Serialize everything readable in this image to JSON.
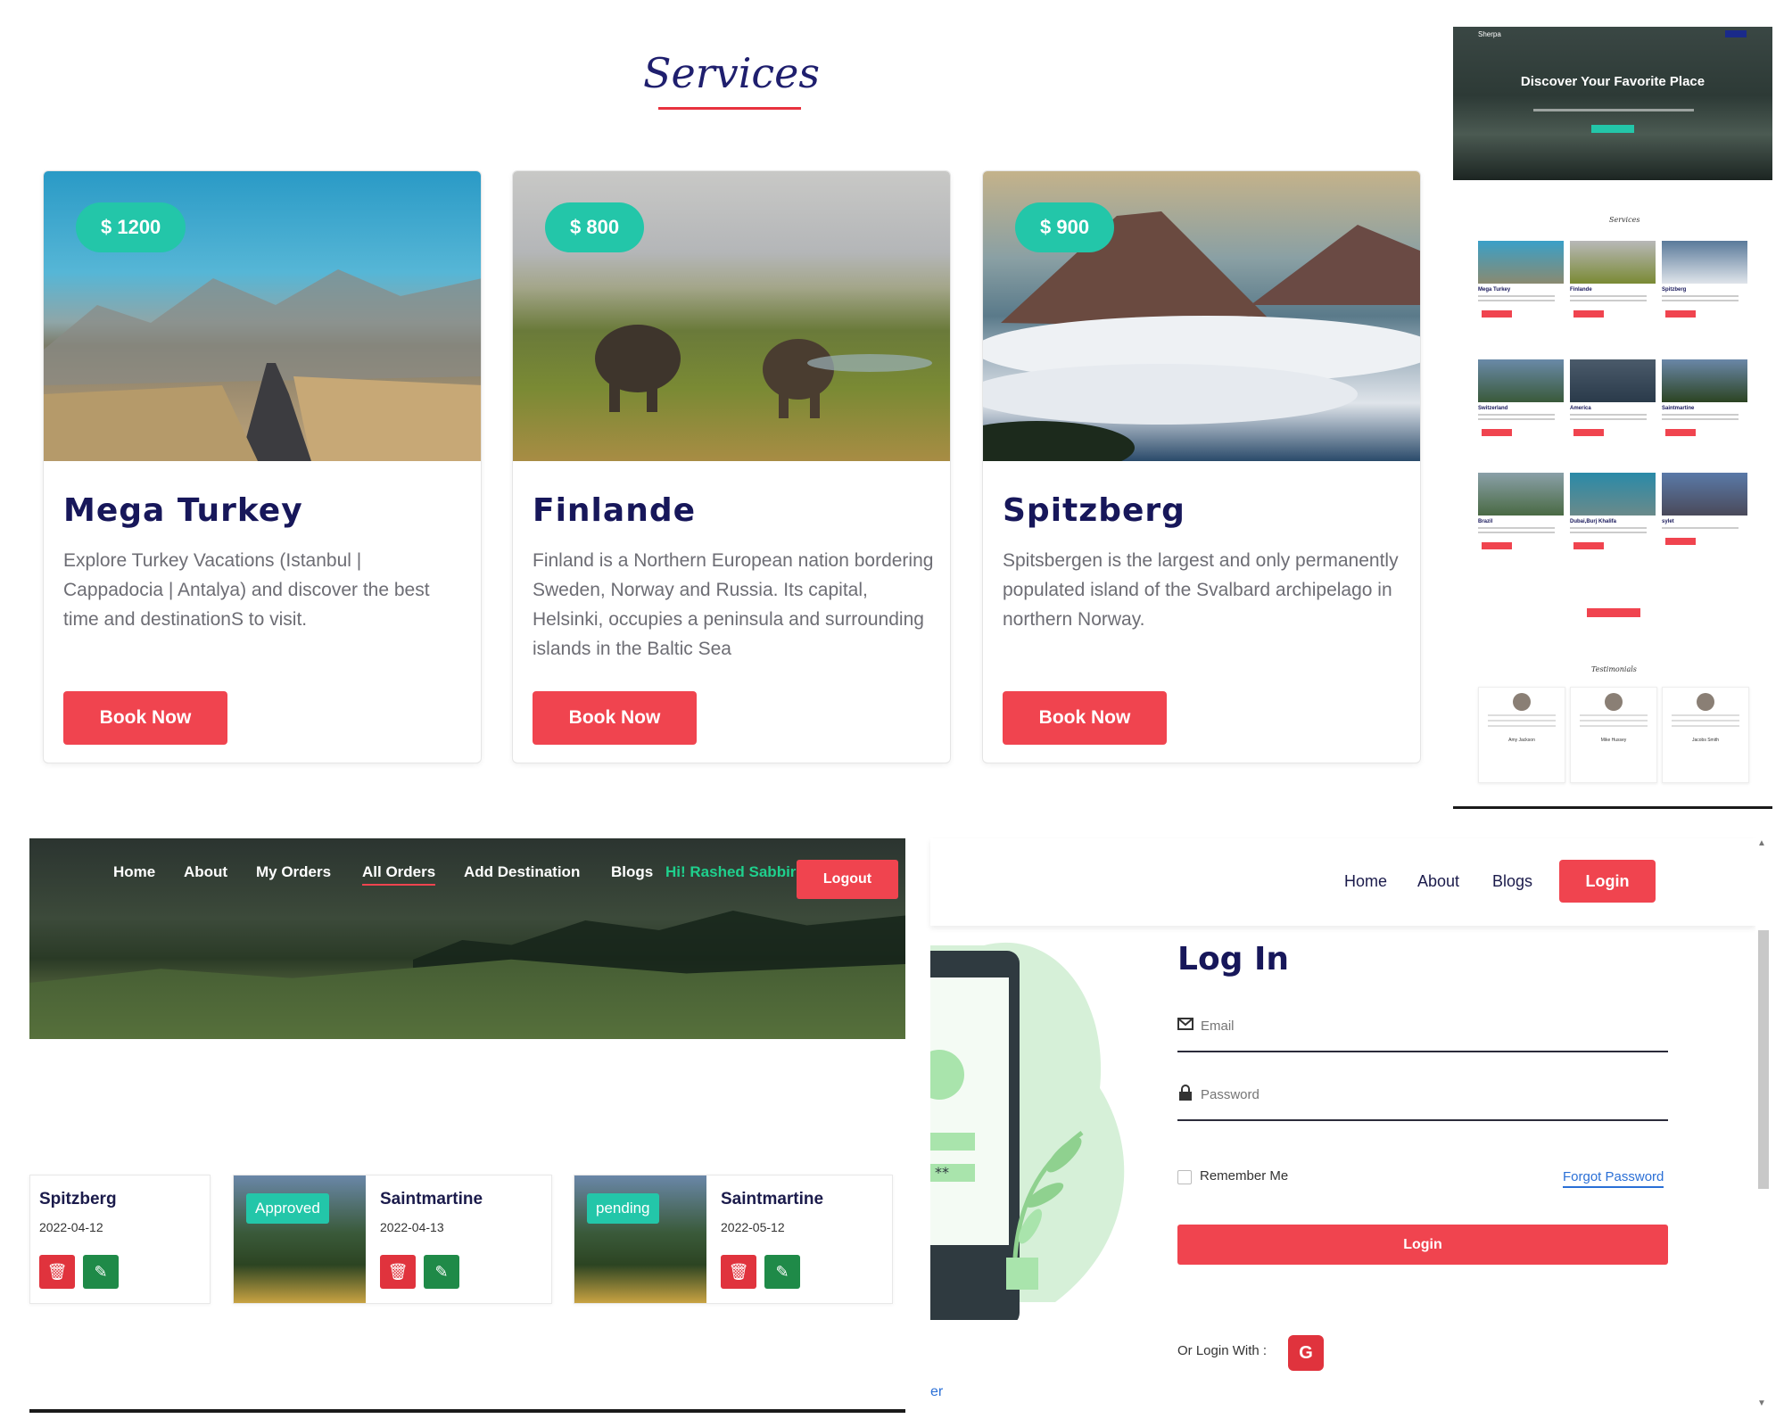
{
  "services": {
    "title": "Services",
    "cards": [
      {
        "price": "$ 1200",
        "title": "Mega Turkey",
        "desc": "Explore Turkey Vacations (Istanbul | Cappadocia | Antalya) and discover the best time and destinationS to visit.",
        "button": "Book Now"
      },
      {
        "price": "$ 800",
        "title": "Finlande",
        "desc": "Finland is a Northern European nation bordering Sweden, Norway and Russia. Its capital, Helsinki, occupies a peninsula and surrounding islands in the Baltic Sea",
        "button": "Book Now"
      },
      {
        "price": "$ 900",
        "title": "Spitzberg",
        "desc": "Spitsbergen is the largest and only permanently populated island of the Svalbard archipelago in northern Norway.",
        "button": "Book Now"
      }
    ]
  },
  "preview": {
    "logo": "Sherpa",
    "hero_title": "Discover Your Favorite Place",
    "services_label": "Services",
    "testimonials_label": "Testimonials",
    "cards": [
      "Mega Turkey",
      "Finlande",
      "Spitzberg",
      "Switzerland",
      "America",
      "Saintmartine",
      "Brazil",
      "Dubai,Burj Khalifa",
      "sylet"
    ],
    "testimonials": [
      "Amy Jackson",
      "Mike Hussey",
      "Jacobs Smith"
    ]
  },
  "orders": {
    "nav": {
      "home": "Home",
      "about": "About",
      "my_orders": "My Orders",
      "all_orders": "All Orders",
      "add_destination": "Add Destination",
      "blogs": "Blogs",
      "user": "Hi! Rashed Sabbir",
      "logout": "Logout"
    },
    "items": [
      {
        "title": "Spitzberg",
        "date": "2022-04-12",
        "status": ""
      },
      {
        "title": "Saintmartine",
        "date": "2022-04-13",
        "status": "Approved"
      },
      {
        "title": "Saintmartine",
        "date": "2022-05-12",
        "status": "pending"
      }
    ]
  },
  "login": {
    "nav": {
      "home": "Home",
      "about": "About",
      "blogs": "Blogs",
      "login": "Login"
    },
    "title": "Log In",
    "email_placeholder": "Email",
    "password_placeholder": "Password",
    "remember": "Remember Me",
    "forgot": "Forgot Password",
    "button": "Login",
    "or_login": "Or Login With :",
    "google": "G",
    "illus_text": "**",
    "corner_text": "er"
  },
  "colors": {
    "accent": "#f0444f",
    "teal": "#23c6a9",
    "navy": "#17175a",
    "green": "#1fd08d"
  }
}
